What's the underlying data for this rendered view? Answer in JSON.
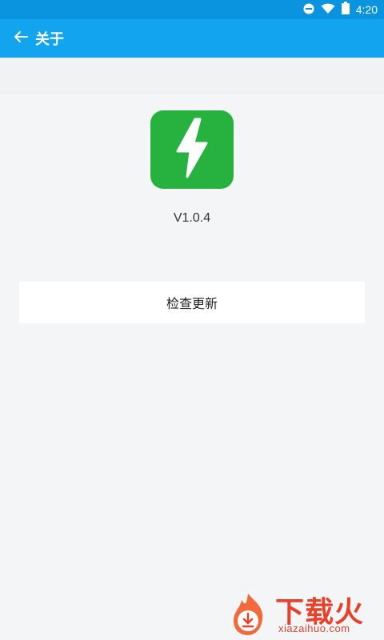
{
  "status_bar": {
    "time": "4:20",
    "icons": [
      "do-not-disturb-icon",
      "wifi-icon",
      "battery-icon"
    ]
  },
  "app_bar": {
    "title": "关于",
    "back_icon": "back-arrow-icon"
  },
  "about": {
    "logo_icon": "lightning-bolt-icon",
    "version": "V1.0.4",
    "check_update_label": "检查更新"
  },
  "watermark": {
    "logo_text": "下载火",
    "site": "xiazaihuo.com"
  },
  "colors": {
    "status_bar": "#0a94e0",
    "app_bar": "#12a4ee",
    "logo_bg": "#27b23f",
    "background": "#f4f5f7",
    "watermark": "#e8402a"
  }
}
